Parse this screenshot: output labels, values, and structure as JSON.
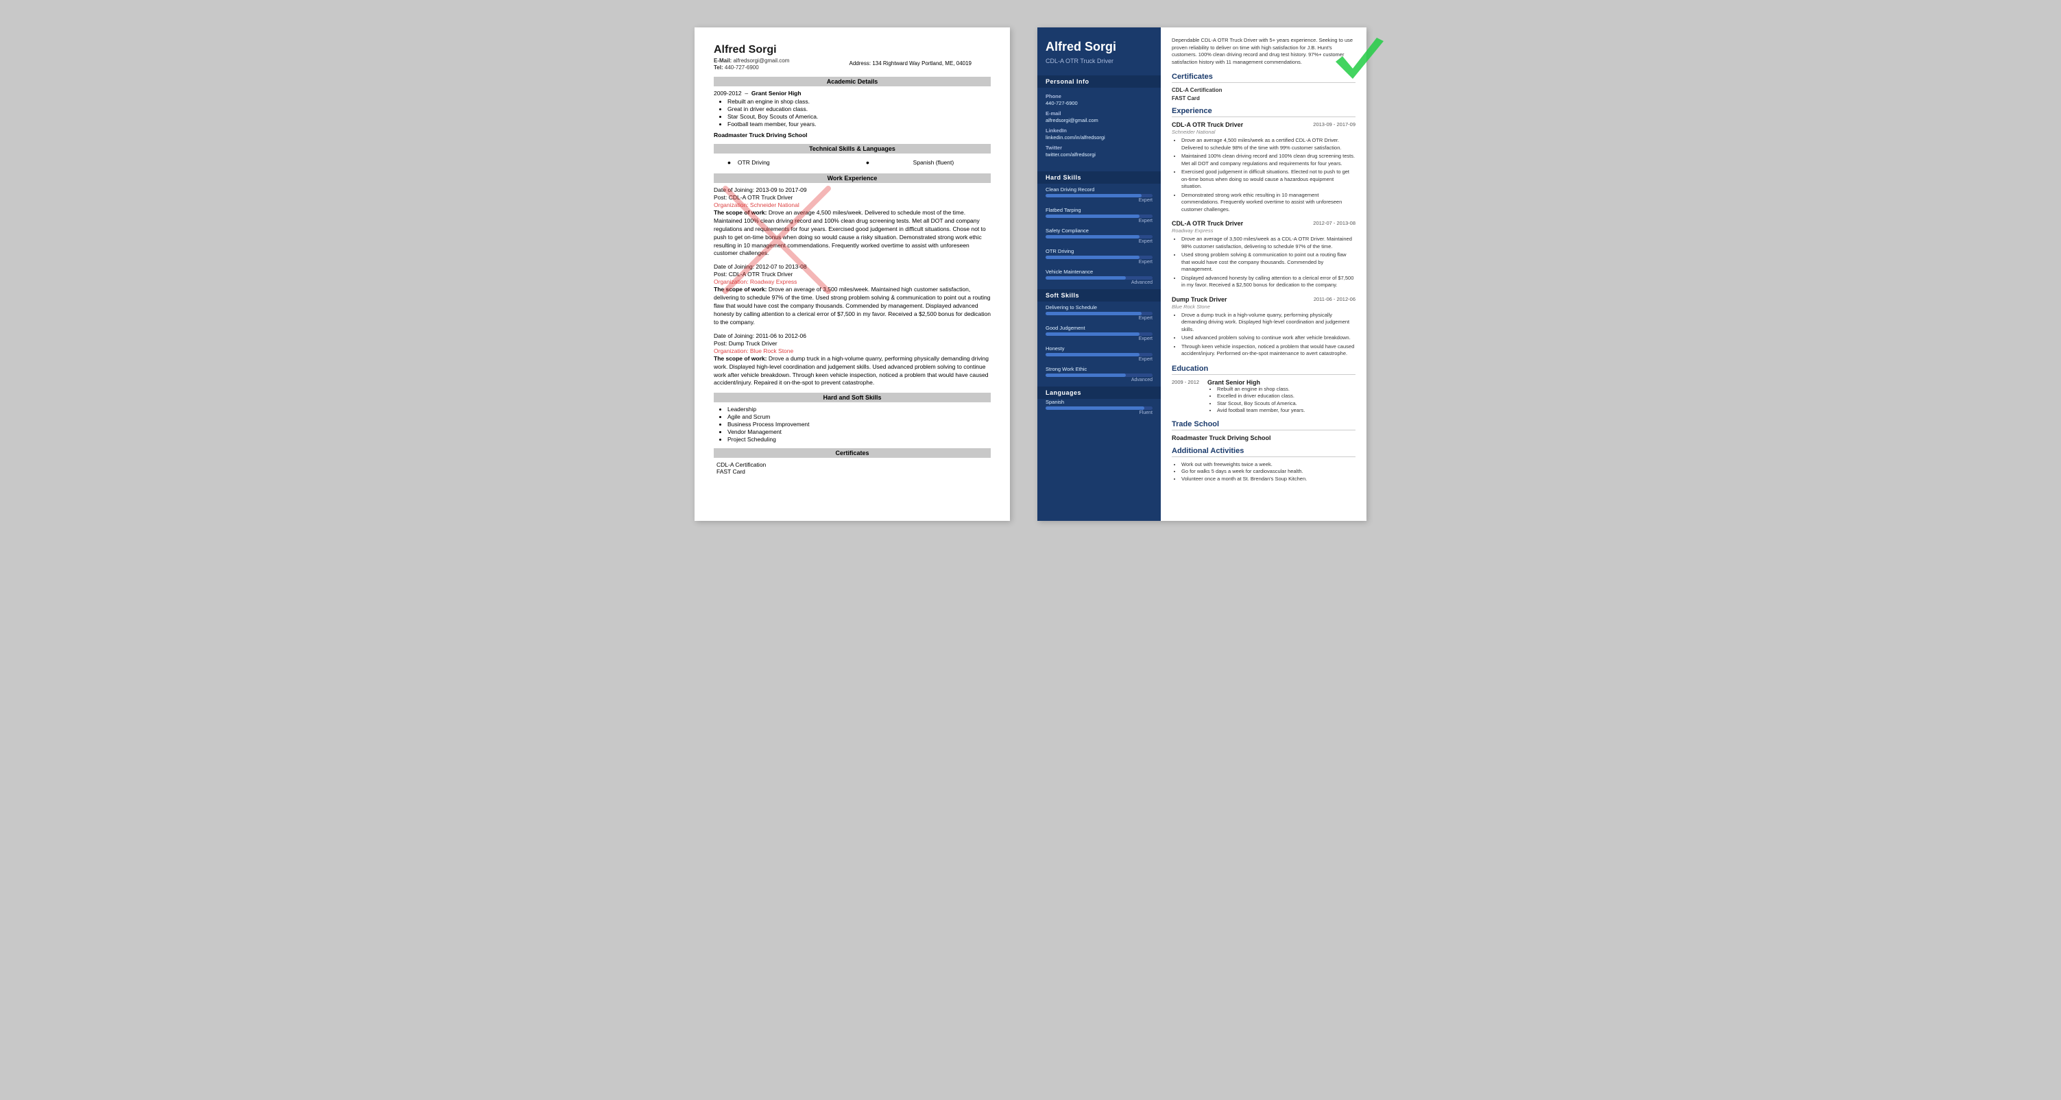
{
  "left_resume": {
    "name": "Alfred Sorgi",
    "email_label": "E-Mail:",
    "email": "alfredsorgi@gmail.com",
    "tel_label": "Tel:",
    "tel": "440-727-6900",
    "address_label": "Address:",
    "address": "134 Rightward Way Portland, ME, 04019",
    "sections": {
      "academic": {
        "title": "Academic Details",
        "period": "2009-2012",
        "school": "Grant Senior High",
        "bullets": [
          "Rebuilt an engine in shop class.",
          "Great in driver education class.",
          "Star Scout, Boy Scouts of America.",
          "Football team member, four years."
        ]
      },
      "roadmaster": "Roadmaster Truck Driving School",
      "technical": {
        "title": "Technical Skills & Languages",
        "skill1": "OTR Driving",
        "skill2": "Spanish (fluent)"
      },
      "work": {
        "title": "Work Experience",
        "entries": [
          {
            "date": "Date of Joining: 2013-09 to 2017-09",
            "post": "Post: CDL-A OTR Truck Driver",
            "org": "Organization: Schneider National",
            "scope_label": "The scope of work:",
            "scope": " Drove an average 4,500 miles/week. Delivered to schedule most of the time. Maintained 100% clean driving record and 100% clean drug screening tests. Met all DOT and company regulations and requirements for four years. Exercised good judgement in difficult situations. Chose not to push to get on-time bonus when doing so would cause a risky situation. Demonstrated strong work ethic resulting in 10 management commendations. Frequently worked overtime to assist with unforeseen customer challenges."
          },
          {
            "date": "Date of Joining: 2012-07 to 2013-08",
            "post": "Post: CDL-A OTR Truck Driver",
            "org": "Organization: Roadway Express",
            "scope_label": "The scope of work:",
            "scope": " Drove an average of 3,500 miles/week. Maintained high customer satisfaction, delivering to schedule 97% of the time. Used strong problem solving & communication to point out a routing flaw that would have cost the company thousands. Commended by management. Displayed advanced honesty by calling attention to a clerical error of $7,500 in my favor. Received a $2,500 bonus for dedication to the company."
          },
          {
            "date": "Date of Joining: 2011-06 to 2012-06",
            "post": "Post: Dump Truck Driver",
            "org": "Organization: Blue Rock Stone",
            "scope_label": "The scope of work:",
            "scope": " Drove a dump truck in a high-volume quarry, performing physically demanding driving work. Displayed high-level coordination and judgement skills. Used advanced problem solving to continue work after vehicle breakdown. Through keen vehicle inspection, noticed a problem that would have caused accident/injury. Repaired it on-the-spot to prevent catastrophe."
          }
        ]
      },
      "hard_skills": {
        "title": "Hard and Soft Skills",
        "bullets": [
          "Leadership",
          "Agile and Scrum",
          "Business Process Improvement",
          "Vendor Management",
          "Project Scheduling"
        ]
      },
      "certificates": {
        "title": "Certificates",
        "items": [
          "CDL-A Certification",
          "FAST Card"
        ]
      }
    }
  },
  "right_resume": {
    "sidebar": {
      "name": "Alfred Sorgi",
      "job_title": "CDL-A OTR Truck Driver",
      "personal_info_title": "Personal Info",
      "phone_label": "Phone",
      "phone": "440-727-6900",
      "email_label": "E-mail",
      "email": "alfredsorgi@gmail.com",
      "linkedin_label": "LinkedIn",
      "linkedin": "linkedin.com/in/alfredsorgi",
      "twitter_label": "Twitter",
      "twitter": "twitter.com/alfredsorgi",
      "hard_skills_title": "Hard Skills",
      "hard_skills": [
        {
          "name": "Clean Driving Record",
          "pct": 90,
          "label": "Expert"
        },
        {
          "name": "Flatbed Tarping",
          "pct": 88,
          "label": "Expert"
        },
        {
          "name": "Safety Compliance",
          "pct": 88,
          "label": "Expert"
        },
        {
          "name": "OTR Driving",
          "pct": 88,
          "label": "Expert"
        },
        {
          "name": "Vehicle Maintenance",
          "pct": 75,
          "label": "Advanced"
        }
      ],
      "soft_skills_title": "Soft Skills",
      "soft_skills": [
        {
          "name": "Delivering to Schedule",
          "pct": 90,
          "label": "Expert"
        },
        {
          "name": "Good Judgement",
          "pct": 88,
          "label": "Expert"
        },
        {
          "name": "Honesty",
          "pct": 88,
          "label": "Expert"
        },
        {
          "name": "Strong Work Ethic",
          "pct": 75,
          "label": "Advanced"
        }
      ],
      "languages_title": "Languages",
      "languages": [
        {
          "name": "Spanish",
          "pct": 92,
          "label": "Fluent"
        }
      ]
    },
    "main": {
      "summary": "Dependable CDL-A OTR Truck Driver with 5+ years experience. Seeking to use proven reliability to deliver on time with high satisfaction for J.B. Hunt's customers. 100% clean driving record and drug test history. 97%+ customer satisfaction history with 11 management commendations.",
      "certificates_title": "Certificates",
      "certificates": [
        "CDL-A Certification",
        "FAST Card"
      ],
      "experience_title": "Experience",
      "experience": [
        {
          "dates": "2013-09 - 2017-09",
          "title": "CDL-A OTR Truck Driver",
          "org": "Schneider National",
          "bullets": [
            "Drove an average 4,500 miles/week as a certified CDL-A OTR Driver. Delivered to schedule 98% of the time with 99% customer satisfaction.",
            "Maintained 100% clean driving record and 100% clean drug screening tests. Met all DOT and company regulations and requirements for four years.",
            "Exercised good judgement in difficult situations. Elected not to push to get on-time bonus when doing so would cause a hazardous equipment situation.",
            "Demonstrated strong work ethic resulting in 10 management commendations. Frequently worked overtime to assist with unforeseen customer challenges."
          ]
        },
        {
          "dates": "2012-07 - 2013-08",
          "title": "CDL-A OTR Truck Driver",
          "org": "Roadway Express",
          "bullets": [
            "Drove an average of 3,500 miles/week as a CDL-A OTR Driver. Maintained 98% customer satisfaction, delivering to schedule 97% of the time.",
            "Used strong problem solving & communication to point out a routing flaw that would have cost the company thousands. Commended by management.",
            "Displayed advanced honesty by calling attention to a clerical error of $7,500 in my favor. Received a $2,500 bonus for dedication to the company."
          ]
        },
        {
          "dates": "2011-06 - 2012-06",
          "title": "Dump Truck Driver",
          "org": "Blue Rock Stone",
          "bullets": [
            "Drove a dump truck in a high-volume quarry, performing physically demanding driving work. Displayed high-level coordination and judgement skills.",
            "Used advanced problem solving to continue work after vehicle breakdown.",
            "Through keen vehicle inspection, noticed a problem that would have caused accident/injury. Performed on-the-spot maintenance to avert catastrophe."
          ]
        }
      ],
      "education_title": "Education",
      "edu_dates": "2009 - 2012",
      "edu_school": "Grant Senior High",
      "edu_bullets": [
        "Rebuilt an engine in shop class.",
        "Excelled in driver education class.",
        "Star Scout, Boy Scouts of America.",
        "Avid football team member, four years."
      ],
      "trade_school_title": "Trade School",
      "trade_school": "Roadmaster Truck Driving School",
      "additional_title": "Additional Activities",
      "additional_bullets": [
        "Work out with freeweights twice a week.",
        "Go for walks 5 days a week for cardiovascular health.",
        "Volunteer once a month at St. Brendan's Soup Kitchen."
      ]
    }
  }
}
